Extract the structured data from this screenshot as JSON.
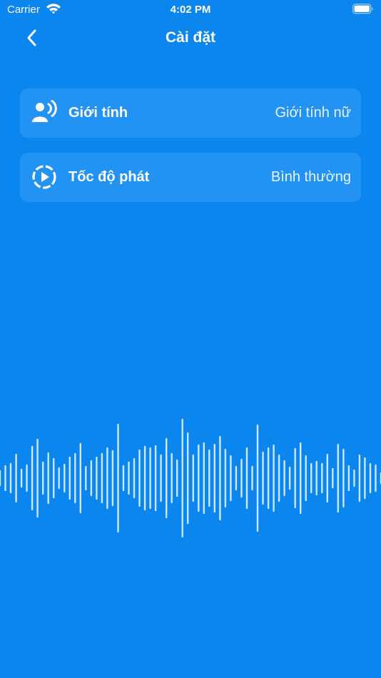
{
  "status_bar": {
    "carrier": "Carrier",
    "time": "4:02 PM"
  },
  "header": {
    "title": "Cài đặt",
    "back_icon": "chevron-left-icon"
  },
  "settings": [
    {
      "icon": "voice-user-icon",
      "label": "Giới tính",
      "value": "Giới tính nữ"
    },
    {
      "icon": "playback-speed-icon",
      "label": "Tốc độ phát",
      "value": "Bình thường"
    }
  ],
  "colors": {
    "background": "#0a86ee",
    "row_background": "#2293f3",
    "waveform": "#cfe7ff"
  }
}
